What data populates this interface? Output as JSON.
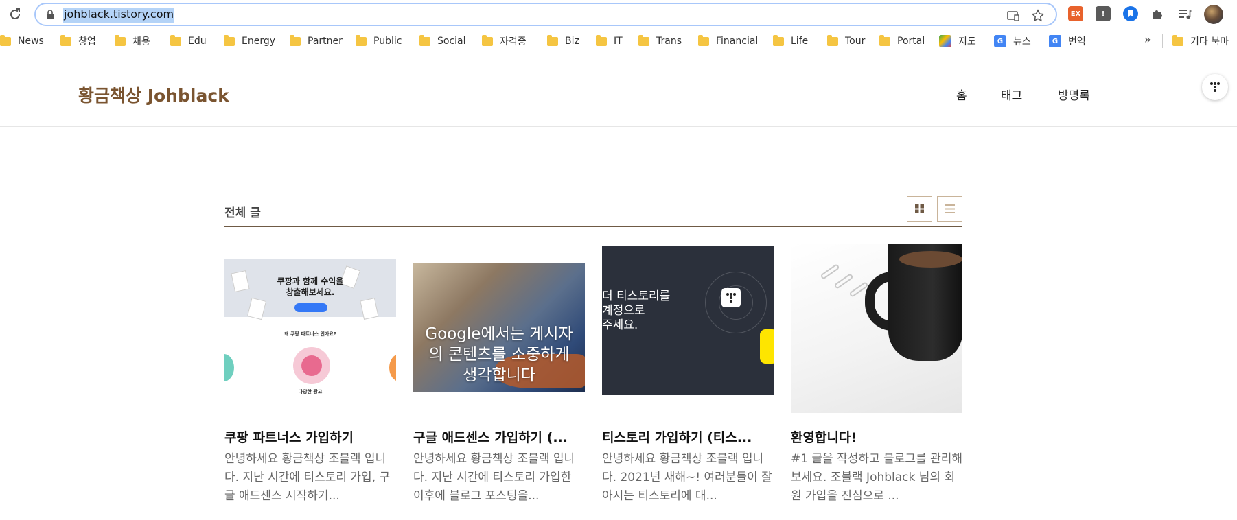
{
  "browser": {
    "url": "johblack.tistory.com",
    "bookmarks": [
      {
        "label": "News",
        "type": "folder"
      },
      {
        "label": "창업",
        "type": "folder"
      },
      {
        "label": "채용",
        "type": "folder"
      },
      {
        "label": "Edu",
        "type": "folder"
      },
      {
        "label": "Energy",
        "type": "folder"
      },
      {
        "label": "Partner",
        "type": "folder"
      },
      {
        "label": "Public",
        "type": "folder"
      },
      {
        "label": "Social",
        "type": "folder"
      },
      {
        "label": "자격증",
        "type": "folder"
      },
      {
        "label": "Biz",
        "type": "folder"
      },
      {
        "label": "IT",
        "type": "folder"
      },
      {
        "label": "Trans",
        "type": "folder"
      },
      {
        "label": "Financial",
        "type": "folder"
      },
      {
        "label": "Life",
        "type": "folder"
      },
      {
        "label": "Tour",
        "type": "folder"
      },
      {
        "label": "Portal",
        "type": "folder"
      },
      {
        "label": "지도",
        "type": "maps"
      },
      {
        "label": "뉴스",
        "type": "news"
      },
      {
        "label": "번역",
        "type": "translate"
      }
    ],
    "overflow_label": "»",
    "other_bookmarks": "기타 북마"
  },
  "blog": {
    "title": "황금책상 Johblack",
    "nav": [
      "홈",
      "태그",
      "방명록"
    ]
  },
  "section": {
    "title": "전체 글"
  },
  "posts": [
    {
      "title": "쿠팡 파트너스 가입하기",
      "excerpt": "안녕하세요 황금책상 조블랙 입니다. 지난 시간에 티스토리 가입, 구글 애드센스 시작하기...",
      "thumb_text": [
        "쿠팡과 함께 수익을",
        "창출해보세요.",
        "왜 쿠팡 파트너스 인가요?",
        "다양한 광고"
      ]
    },
    {
      "title": "구글 애드센스 가입하기 (...",
      "excerpt": "안녕하세요 황금책상 조블랙 입니다. 지난 시간에 티스토리 가입한 이후에 블로그 포스팅을...",
      "thumb_text": [
        "Google에서는 게시자",
        "의 콘텐츠를 소중하게",
        "생각합니다"
      ]
    },
    {
      "title": "티스토리 가입하기 (티스...",
      "excerpt": "안녕하세요 황금책상 조블랙 입니다. 2021년 새해~! 여러분들이 잘 아시는 티스토리에 대...",
      "thumb_text": [
        "더 티스토리를",
        "계정으로",
        "주세요."
      ]
    },
    {
      "title": "환영합니다!",
      "excerpt": "#1 글을 작성하고 블로그를 관리해보세요. 조블랙 Johblack 님의 회원 가입을 진심으로 ...",
      "thumb_text": []
    }
  ],
  "colors": {
    "brand": "#7a5430",
    "accent_border": "#c9b49a",
    "omnibox_focus": "#a8c7fa",
    "url_highlight": "#b4d3f7"
  },
  "icons": {
    "reload": "reload-icon",
    "lock": "lock-icon",
    "cast": "cast-icon",
    "star": "bookmark-star-icon",
    "extensions": "puzzle-icon",
    "media": "media-control-icon",
    "menu": "kebab-menu-icon",
    "grid_view": "grid-view-icon",
    "list_view": "list-view-icon"
  }
}
